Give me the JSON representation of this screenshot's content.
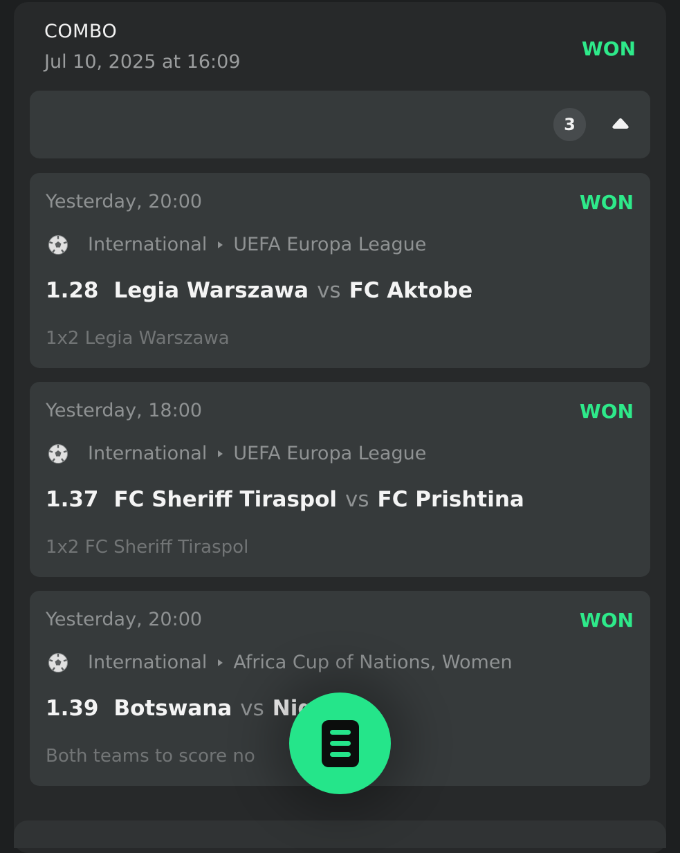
{
  "bet": {
    "type": "COMBO",
    "placed_at": "Jul 10, 2025 at 16:09",
    "status": "WON",
    "legs_count": "3"
  },
  "legs": [
    {
      "time": "Yesterday, 20:00",
      "status": "WON",
      "category": "International",
      "league": "UEFA Europa League",
      "odds": "1.28",
      "home": "Legia Warszawa",
      "vs": "vs",
      "away": "FC Aktobe",
      "selection": "1x2 Legia Warszawa"
    },
    {
      "time": "Yesterday, 18:00",
      "status": "WON",
      "category": "International",
      "league": "UEFA Europa League",
      "odds": "1.37",
      "home": "FC Sheriff Tiraspol",
      "vs": "vs",
      "away": "FC Prishtina",
      "selection": "1x2 FC Sheriff Tiraspol"
    },
    {
      "time": "Yesterday, 20:00",
      "status": "WON",
      "category": "International",
      "league": "Africa Cup of Nations, Women",
      "odds": "1.39",
      "home": "Botswana",
      "vs": "vs",
      "away": "Nigeria",
      "selection": "Both teams to score no"
    }
  ],
  "icons": {
    "sport": "soccer-ball-icon",
    "collapse": "caret-up-icon",
    "fab": "betslip-icon"
  },
  "colors": {
    "won": "#2ee98a",
    "accent": "#25e58a",
    "card": "#27292a",
    "leg": "#363a3b"
  }
}
